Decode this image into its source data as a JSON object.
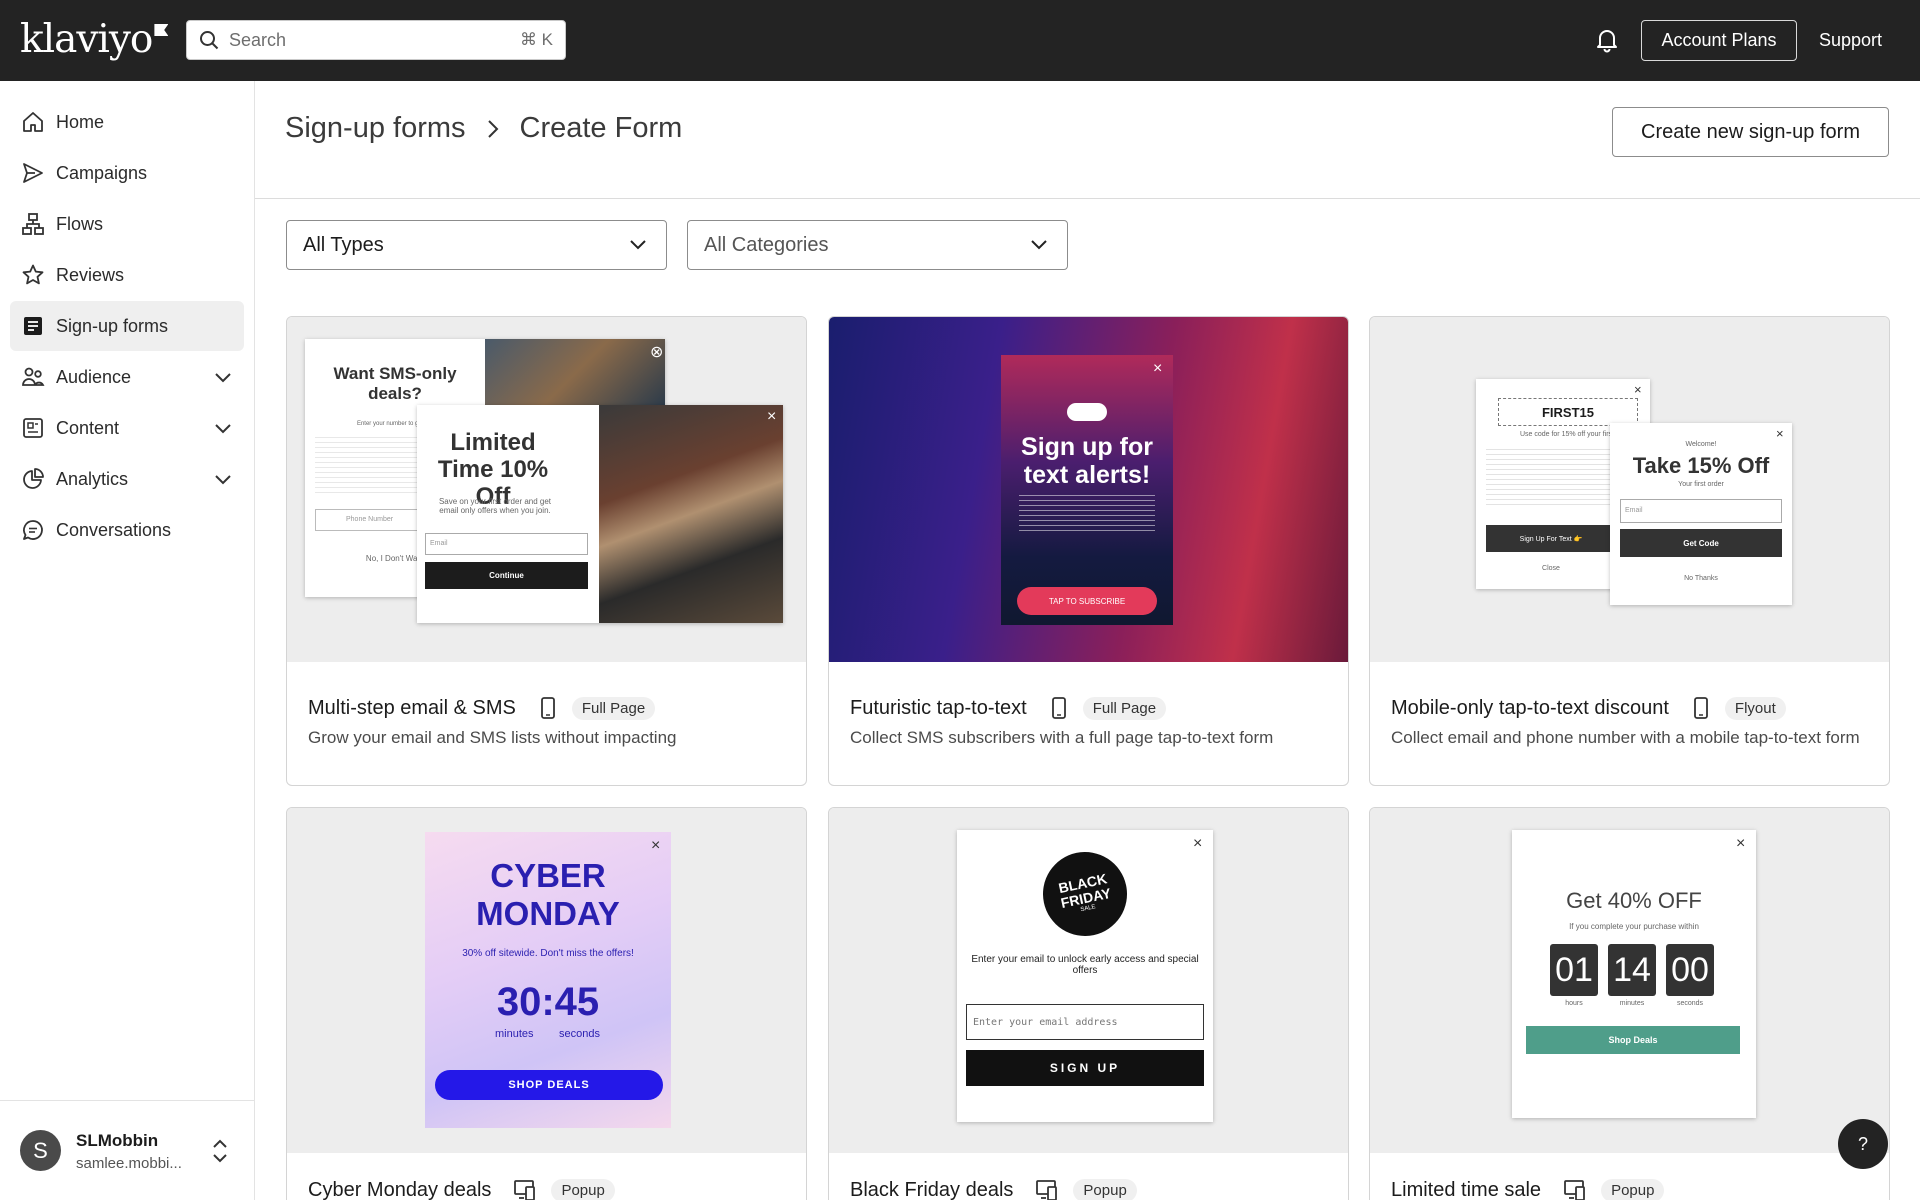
{
  "app": {
    "logo": "klaviyo"
  },
  "topbar": {
    "search_placeholder": "Search",
    "search_shortcut": "⌘ K",
    "account_plans": "Account Plans",
    "support": "Support"
  },
  "sidebar": {
    "items": [
      {
        "label": "Home",
        "icon": "home-icon"
      },
      {
        "label": "Campaigns",
        "icon": "send-icon"
      },
      {
        "label": "Flows",
        "icon": "flows-icon"
      },
      {
        "label": "Reviews",
        "icon": "star-icon"
      },
      {
        "label": "Sign-up forms",
        "icon": "form-icon",
        "active": true
      },
      {
        "label": "Audience",
        "icon": "people-icon",
        "expandable": true
      },
      {
        "label": "Content",
        "icon": "content-icon",
        "expandable": true
      },
      {
        "label": "Analytics",
        "icon": "pie-chart-icon",
        "expandable": true
      },
      {
        "label": "Conversations",
        "icon": "chat-icon"
      }
    ],
    "user": {
      "initial": "S",
      "name": "SLMobbin",
      "email": "samlee.mobbi..."
    }
  },
  "header": {
    "breadcrumb_parent": "Sign-up forms",
    "breadcrumb_current": "Create Form",
    "create_button": "Create new sign-up form"
  },
  "filters": {
    "types": "All Types",
    "categories": "All Categories"
  },
  "cards": [
    {
      "title": "Multi-step email & SMS",
      "badge": "Full Page",
      "desc": "Grow your email and SMS lists without impacting",
      "preview": {
        "sms_title": "Want SMS-only deals?",
        "sms_sub": "Enter your number to get S",
        "phone": "Phone Number",
        "no": "No, I Don't Want",
        "headline": "Limited Time 10% Off",
        "body": "Save on your first order and get email only offers when you join.",
        "email": "Email",
        "cta": "Continue"
      }
    },
    {
      "title": "Futuristic tap-to-text",
      "badge": "Full Page",
      "desc": "Collect SMS subscribers with a full page tap-to-text form",
      "preview": {
        "headline": "Sign up for text alerts!",
        "cta": "TAP TO SUBSCRIBE"
      }
    },
    {
      "title": "Mobile-only tap-to-text discount",
      "badge": "Flyout",
      "desc": "Collect email and phone number with a mobile tap-to-text form",
      "preview": {
        "code": "FIRST15",
        "code_sub": "Use code for 15% off your firs",
        "sms_cta": "Sign Up For Text 👉",
        "close": "Close",
        "welcome": "Welcome!",
        "headline": "Take 15% Off",
        "sub": "Your first order",
        "email": "Email",
        "cta": "Get Code",
        "no": "No Thanks"
      }
    },
    {
      "title": "Cyber Monday deals",
      "badge": "Popup",
      "desc": "",
      "preview": {
        "line1": "CYBER",
        "line2": "MONDAY",
        "offer": "30% off sitewide. Don't miss the offers!",
        "timer": "30:45",
        "minutes": "minutes",
        "seconds": "seconds",
        "cta": "SHOP DEALS"
      }
    },
    {
      "title": "Black Friday deals",
      "badge": "Popup",
      "desc": "",
      "preview": {
        "seal1": "BLACK",
        "seal2": "FRIDAY",
        "seal3": "SALE",
        "body": "Enter your email to unlock early access and special offers",
        "email": "Enter your email address",
        "cta": "SIGN UP"
      }
    },
    {
      "title": "Limited time sale",
      "badge": "Popup",
      "desc": "",
      "preview": {
        "headline": "Get 40% OFF",
        "sub": "If you complete your purchase within",
        "h": "01",
        "m": "14",
        "s": "00",
        "hl": "hours",
        "ml": "minutes",
        "sl": "seconds",
        "cta": "Shop Deals"
      }
    }
  ],
  "help": "?"
}
